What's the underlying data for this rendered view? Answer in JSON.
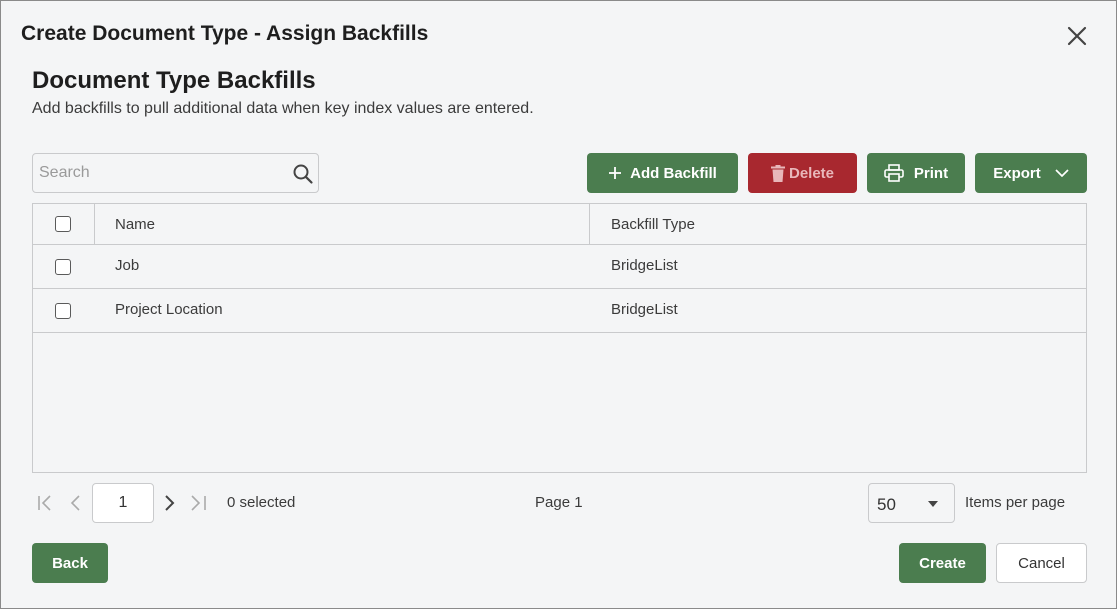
{
  "dialog": {
    "title": "Create Document Type - Assign Backfills",
    "close_icon": "close-icon"
  },
  "section": {
    "title": "Document Type Backfills",
    "description": "Add backfills to pull additional data when key index values are entered."
  },
  "search": {
    "placeholder": "Search",
    "value": "",
    "icon": "search-icon"
  },
  "toolbar": {
    "add_label": "Add Backfill",
    "delete_label": "Delete",
    "print_label": "Print",
    "export_label": "Export"
  },
  "table": {
    "columns": [
      "Name",
      "Backfill Type"
    ],
    "rows": [
      {
        "name": "Job",
        "type": "BridgeList"
      },
      {
        "name": "Project Location",
        "type": "BridgeList"
      }
    ]
  },
  "pager": {
    "page_value": "1",
    "selected_text": "0 selected",
    "page_label": "Page 1",
    "per_page_value": "50",
    "per_page_label": "Items per page"
  },
  "footer": {
    "back_label": "Back",
    "create_label": "Create",
    "cancel_label": "Cancel"
  },
  "colors": {
    "primary_green": "#4b7d4f",
    "danger_red": "#a8282f",
    "background": "#f4f5f6",
    "border": "#c9cacc"
  }
}
